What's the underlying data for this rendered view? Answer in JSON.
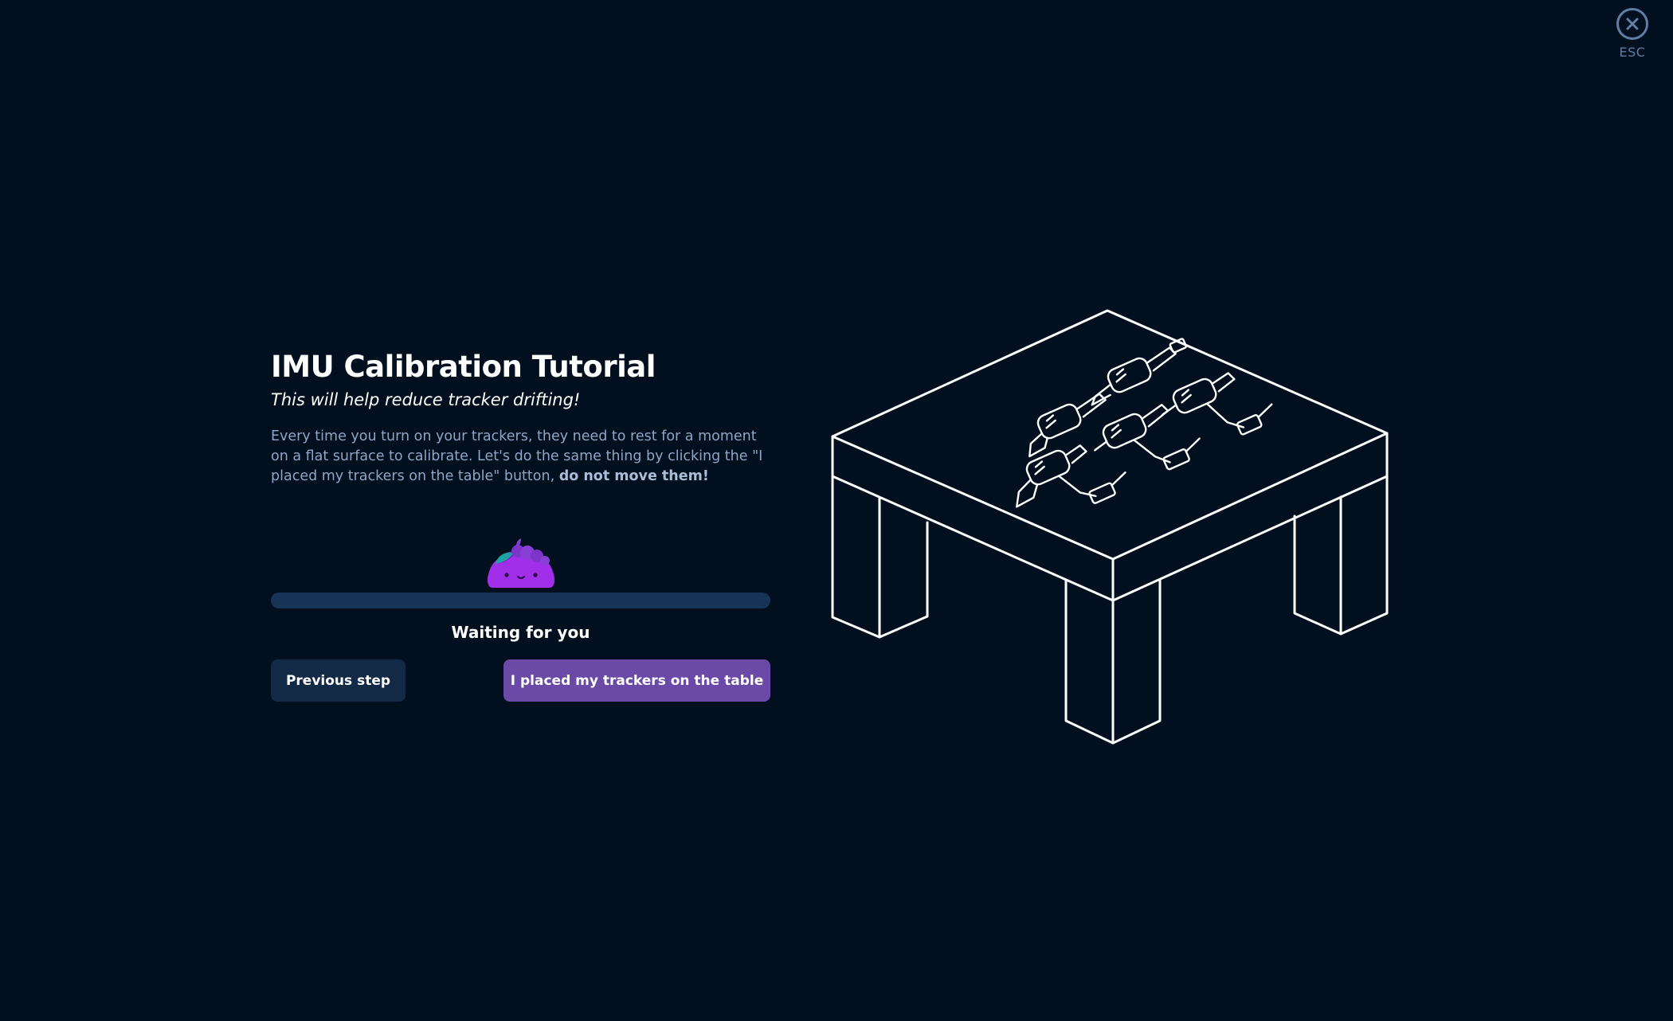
{
  "close": {
    "icon": "close-icon",
    "label": "ESC",
    "color": "#5f7ea5"
  },
  "tutorial": {
    "title": "IMU Calibration Tutorial",
    "subtitle": "This will help reduce tracker drifting!",
    "description_text": "Every time you turn on your trackers, they need to rest for a moment on a flat surface to calibrate. Let's do the same thing by clicking the \"I placed my trackers on the table\" button, ",
    "description_emphasis": "do not move them!"
  },
  "progress": {
    "mascot_icon": "slime-mascot-icon",
    "value_percent": 0,
    "status": "Waiting for you"
  },
  "buttons": {
    "previous_label": "Previous step",
    "confirm_label": "I placed my trackers on the table"
  },
  "illustration": {
    "icon": "table-with-trackers-illustration"
  },
  "colors": {
    "background": "#020f1e",
    "accent": "#6a4aa6",
    "secondary_button": "#132a46",
    "progress_track": "#163556",
    "muted_text": "#8ea6c6",
    "mascot": "#a12ee8"
  }
}
